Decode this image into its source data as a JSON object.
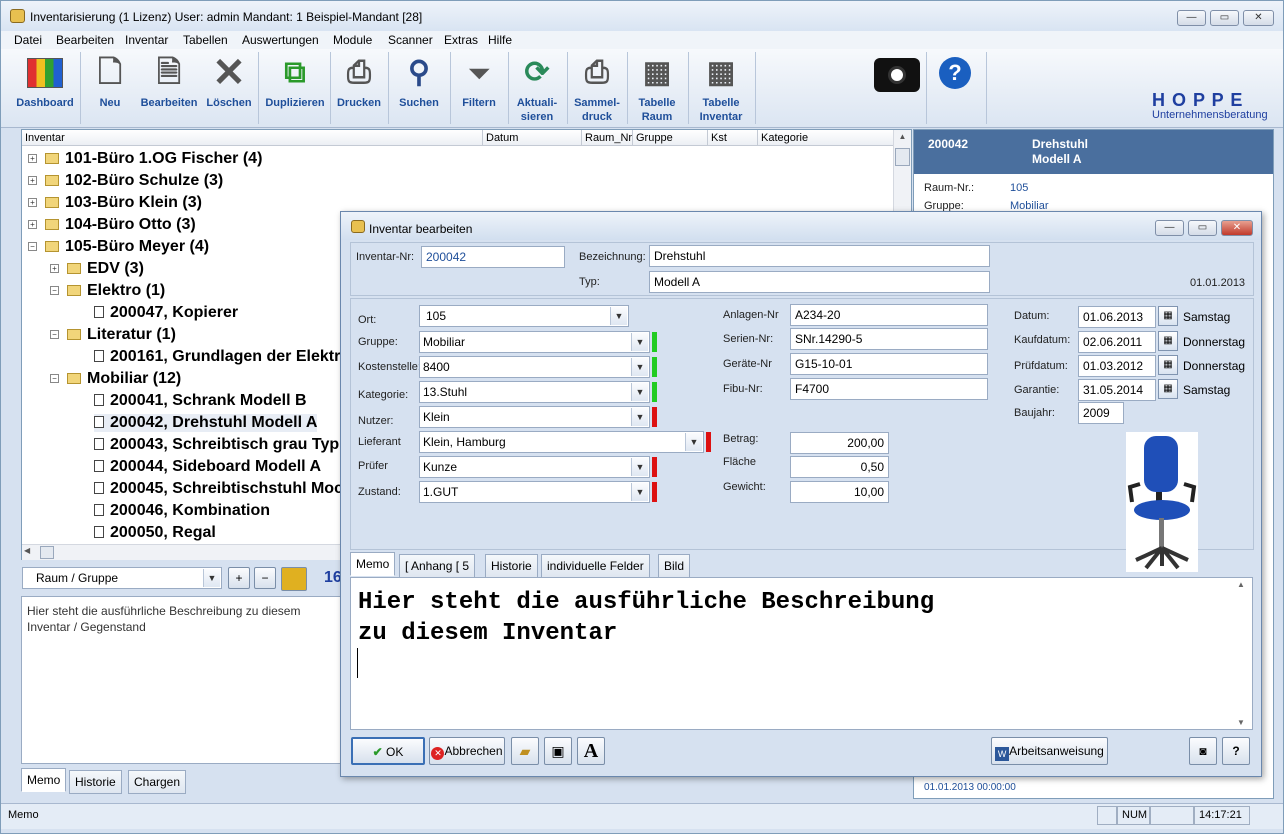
{
  "window": {
    "title": "Inventarisierung  (1 Lizenz)   User: admin   Mandant: 1 Beispiel-Mandant [28]",
    "minimize": "—",
    "maximize": "▭",
    "close": "✕"
  },
  "menu": [
    "Datei",
    "Bearbeiten",
    "Inventar",
    "Tabellen",
    "Auswertungen",
    "Module",
    "Scanner",
    "Extras",
    "Hilfe"
  ],
  "toolbar": [
    {
      "label": "Dashboard",
      "label2": ""
    },
    {
      "label": "Neu",
      "label2": ""
    },
    {
      "label": "Bearbeiten",
      "label2": ""
    },
    {
      "label": "Löschen",
      "label2": ""
    },
    {
      "label": "Duplizieren",
      "label2": ""
    },
    {
      "label": "Drucken",
      "label2": ""
    },
    {
      "label": "Suchen",
      "label2": ""
    },
    {
      "label": "Filtern",
      "label2": ""
    },
    {
      "label": "Aktuali-",
      "label2": "sieren"
    },
    {
      "label": "Sammel-",
      "label2": "druck"
    },
    {
      "label": "Tabelle",
      "label2": "Raum"
    },
    {
      "label": "Tabelle",
      "label2": "Inventar"
    }
  ],
  "brand": {
    "name": "H O P P E",
    "sub": "Unternehmensberatung"
  },
  "list": {
    "columns": [
      "Inventar",
      "Datum",
      "Raum_Nr",
      "Gruppe",
      "Kst",
      "Kategorie"
    ],
    "items": [
      "101-Büro 1.OG  Fischer  (4)",
      "102-Büro  Schulze  (3)",
      "103-Büro Klein  (3)",
      "104-Büro  Otto  (3)",
      "105-Büro  Meyer  (4)",
      "EDV  (3)",
      "Elektro  (1)",
      "200047, Kopierer",
      "Literatur  (1)",
      "200161, Grundlagen der Elektr",
      "Mobiliar  (12)",
      "200041, Schrank Modell B",
      "200042, Drehstuhl Modell A",
      "200043, Schreibtisch grau Typ",
      "200044, Sideboard Modell A",
      "200045, Schreibtischstuhl Moc",
      "200046, Kombination",
      "200050, Regal"
    ]
  },
  "grouping": {
    "value": "Raum / Gruppe",
    "count": "16"
  },
  "memo_left": "Hier steht die ausführliche Beschreibung zu diesem Inventar / Gegenstand",
  "bottom_tabs": [
    "Memo",
    "Historie",
    "Chargen"
  ],
  "detail": {
    "id": "200042",
    "name1": "Drehstuhl",
    "name2": "Modell A",
    "raum_label": "Raum-Nr.:",
    "raum_value": "105",
    "gruppe_label": "Gruppe:",
    "gruppe_value": "Mobiliar",
    "footer": "01.01.2013 00:00:00"
  },
  "dialog": {
    "title": "Inventar bearbeiten",
    "inventar_nr_label": "Inventar-Nr:",
    "inventar_nr": "200042",
    "bezeichnung_label": "Bezeichnung:",
    "bezeichnung": "Drehstuhl",
    "typ_label": "Typ:",
    "typ": "Modell A",
    "created": "01.01.2013",
    "left_fields": [
      {
        "label": "Ort:",
        "value": "105"
      },
      {
        "label": "Gruppe:",
        "value": "Mobiliar"
      },
      {
        "label": "Kostenstelle:",
        "value": "8400"
      },
      {
        "label": "Kategorie:",
        "value": "13.Stuhl"
      },
      {
        "label": "Nutzer:",
        "value": "Klein"
      },
      {
        "label": "Lieferant",
        "value": "Klein, Hamburg"
      },
      {
        "label": "Prüfer",
        "value": "Kunze"
      },
      {
        "label": "Zustand:",
        "value": "1.GUT"
      }
    ],
    "mid_fields": [
      {
        "label": "Anlagen-Nr",
        "value": "A234-20"
      },
      {
        "label": "Serien-Nr:",
        "value": "SNr.14290-5"
      },
      {
        "label": "Geräte-Nr",
        "value": "G15-10-01"
      },
      {
        "label": "Fibu-Nr:",
        "value": "F4700"
      }
    ],
    "amount_fields": [
      {
        "label": "Betrag:",
        "value": "200,00"
      },
      {
        "label": "Fläche",
        "value": "0,50"
      },
      {
        "label": "Gewicht:",
        "value": "10,00"
      }
    ],
    "date_fields": [
      {
        "label": "Datum:",
        "value": "01.06.2013",
        "day": "Samstag"
      },
      {
        "label": "Kaufdatum:",
        "value": "02.06.2011",
        "day": "Donnerstag"
      },
      {
        "label": "Prüfdatum:",
        "value": "01.03.2012",
        "day": "Donnerstag"
      },
      {
        "label": "Garantie:",
        "value": "31.05.2014",
        "day": "Samstag"
      }
    ],
    "baujahr_label": "Baujahr:",
    "baujahr": "2009",
    "tabs": [
      "Memo",
      "[ Anhang [  5",
      "Historie",
      "individuelle Felder",
      "Bild"
    ],
    "memo_line1": "Hier steht die ausführliche Beschreibung",
    "memo_line2": "zu diesem Inventar",
    "ok": "OK",
    "cancel": "Abbrechen",
    "arbeitsanweisung": "Arbeitsanweisung",
    "font_button": "A",
    "help_button": "?"
  },
  "status": {
    "left": "Memo",
    "num": "NUM",
    "time": "14:17:21"
  },
  "colors": {
    "green": "#22cc22",
    "red": "#dd1111",
    "brand": "#1f3fa0"
  }
}
